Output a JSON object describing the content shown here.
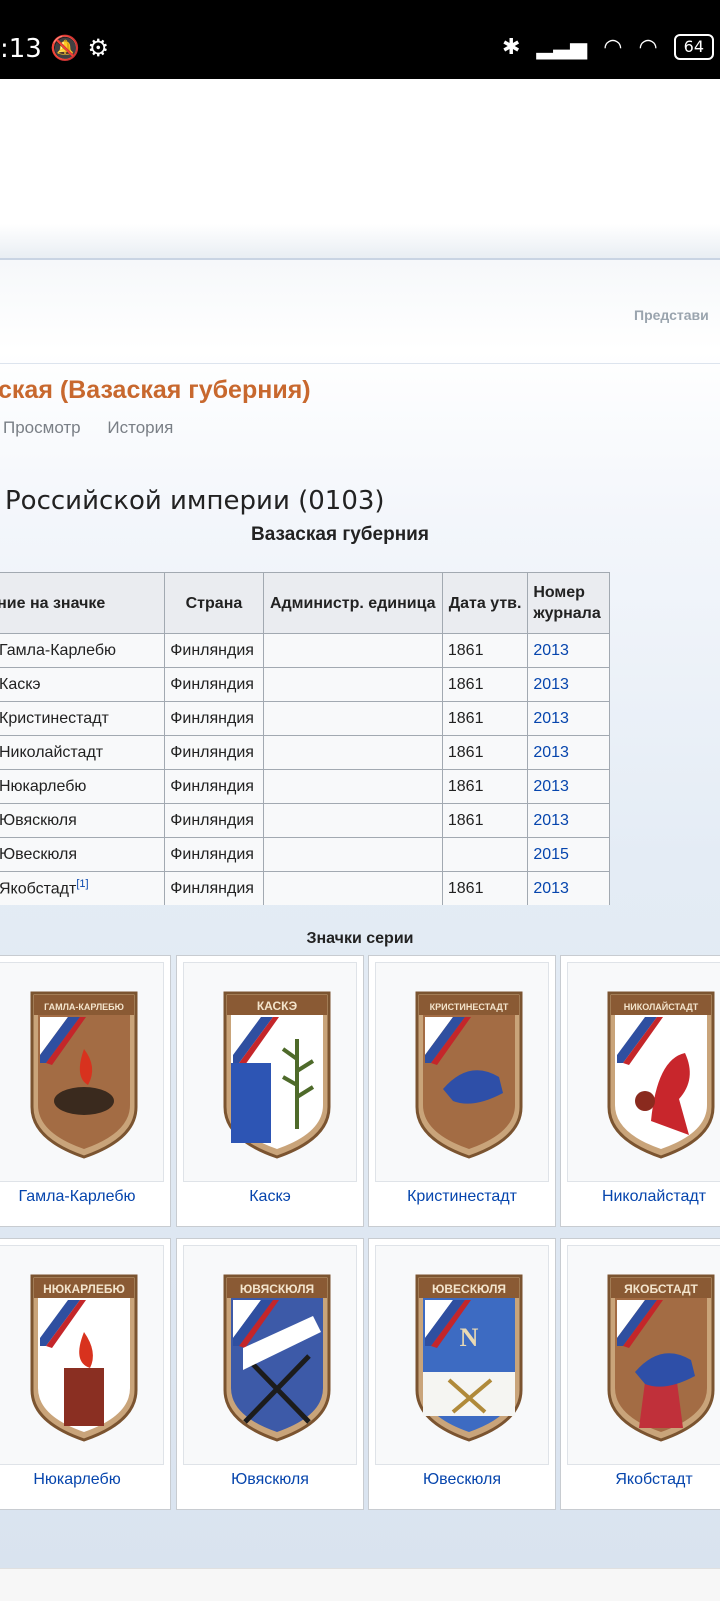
{
  "status": {
    "time": ":13",
    "left_icons": [
      "mute-icon",
      "gear-icon"
    ],
    "right_icons": [
      "bluetooth-icon",
      "signal-icon",
      "wifi-icon",
      "wifi-icon"
    ],
    "battery": "64"
  },
  "header": {
    "represent": "Представи"
  },
  "page": {
    "title": "ская (Вазаская губерния)",
    "tabs": [
      "Просмотр",
      "История"
    ],
    "section_heading": "Российской империи (0103)"
  },
  "table": {
    "caption": "Вазаская губерния",
    "headers": [
      "Название на значке",
      "Страна",
      "Администр. единица",
      "Дата утв.",
      "Номер журнала"
    ],
    "rows": [
      {
        "name": "Гамла-Карлебю",
        "country": "Финляндия",
        "admin": "",
        "date": "1861",
        "num": "2013"
      },
      {
        "name": "Каскэ",
        "country": "Финляндия",
        "admin": "",
        "date": "1861",
        "num": "2013"
      },
      {
        "name": "Кристинестадт",
        "country": "Финляндия",
        "admin": "",
        "date": "1861",
        "num": "2013"
      },
      {
        "name": "Николайстадт",
        "country": "Финляндия",
        "admin": "",
        "date": "1861",
        "num": "2013"
      },
      {
        "name": "Нюкарлебю",
        "country": "Финляндия",
        "admin": "",
        "date": "1861",
        "num": "2013"
      },
      {
        "name": "Ювяскюля",
        "country": "Финляндия",
        "admin": "",
        "date": "1861",
        "num": "2013"
      },
      {
        "name": "Ювескюля",
        "country": "Финляндия",
        "admin": "",
        "date": "",
        "num": "2015"
      },
      {
        "name": "Якобстадт",
        "country": "Финляндия",
        "admin": "",
        "date": "1861",
        "num": "2013",
        "ref": "[1]"
      }
    ]
  },
  "gallery": {
    "title": "Значки серии",
    "items": [
      {
        "label": "Гамла-Карлебю",
        "banner": "ГАМЛА-КАРЛЕБЮ",
        "shield": "#a36c44",
        "icon": "barrel"
      },
      {
        "label": "Каскэ",
        "banner": "КАСКЭ",
        "shield": "#ffffff",
        "icon": "branch"
      },
      {
        "label": "Кристинестадт",
        "banner": "КРИСТИНЕСТАДТ",
        "shield": "#a36c44",
        "icon": "lion"
      },
      {
        "label": "Николайстадт",
        "banner": "НИКОЛАЙСТАДТ",
        "shield": "#ffffff",
        "icon": "griffin"
      },
      {
        "label": "Нюкарлебю",
        "banner": "НЮКАРЛЕБЮ",
        "shield": "#ffffff",
        "icon": "tower"
      },
      {
        "label": "Ювяскюля",
        "banner": "ЮВЯСКЮЛЯ",
        "shield": "#3d5aa8",
        "icon": "tools"
      },
      {
        "label": "Ювескюля",
        "banner": "ЮВЕСКЮЛЯ",
        "shield": "#3d6bc2",
        "icon": "caduceus"
      },
      {
        "label": "Якобстадт",
        "banner": "ЯКОБСТАДТ",
        "shield": "#a36c44",
        "icon": "tower-lion"
      }
    ]
  }
}
